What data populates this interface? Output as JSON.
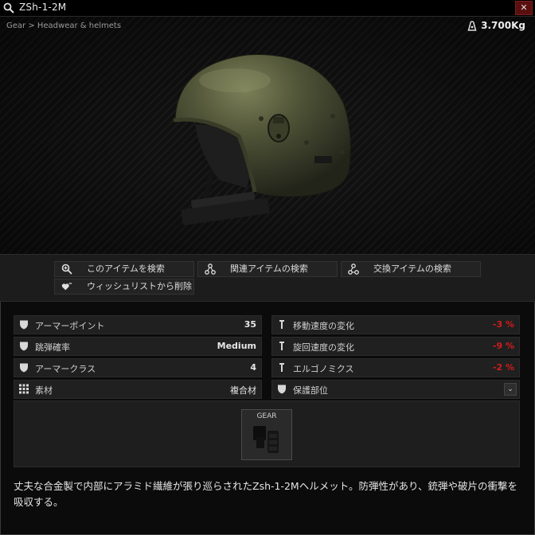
{
  "window": {
    "title": "ZSh-1-2M",
    "close_label": "✕"
  },
  "item": {
    "breadcrumb": "Gear > Headwear & helmets",
    "weight": "3.700Kg",
    "colors": {
      "helmet": "#4b4e33",
      "background_stripe": "#1a1a1a"
    }
  },
  "actions": [
    {
      "label": "このアイテムを検索",
      "icon": "magnify-icon"
    },
    {
      "label": "関連アイテムの検索",
      "icon": "related-items-icon"
    },
    {
      "label": "交換アイテムの検索",
      "icon": "barter-items-icon"
    },
    {
      "label": "ウィッシュリストから削除",
      "icon": "wishlist-heart-icon"
    }
  ],
  "stats_left": [
    {
      "label": "アーマーポイント",
      "value": "35",
      "icon": "shield-icon"
    },
    {
      "label": "跳弾確率",
      "value": "Medium",
      "icon": "shield-icon"
    },
    {
      "label": "アーマークラス",
      "value": "4",
      "icon": "shield-icon"
    },
    {
      "label": "素材",
      "value": "複合材",
      "icon": "grid-icon"
    }
  ],
  "stats_right": [
    {
      "label": "移動速度の変化",
      "value": "-3 %",
      "icon": "weight-icon",
      "negative": true
    },
    {
      "label": "旋回速度の変化",
      "value": "-9 %",
      "icon": "weight-icon",
      "negative": true
    },
    {
      "label": "エルゴノミクス",
      "value": "-2 %",
      "icon": "weight-icon",
      "negative": true
    },
    {
      "label": "保護部位",
      "value": "",
      "icon": "shield-icon",
      "dropdown": "⌄"
    }
  ],
  "slots": [
    {
      "label": "GEAR"
    }
  ],
  "description": "丈夫な合金製で内部にアラミド繊維が張り巡らされたZsh-1-2Mヘルメット。防弾性があり、銃弾や破片の衝撃を吸収する。",
  "colors": {
    "accent_negative": "#d21c1c",
    "panel": "#202020"
  }
}
